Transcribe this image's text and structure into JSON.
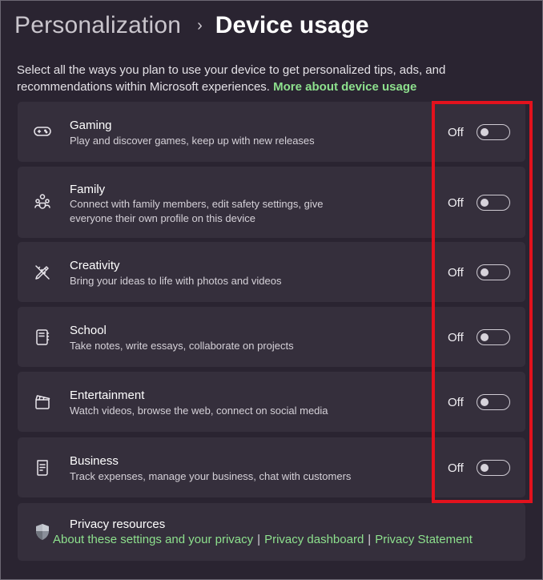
{
  "breadcrumb": {
    "parent": "Personalization",
    "separator": "›",
    "current": "Device usage"
  },
  "description": {
    "text": "Select all the ways you plan to use your device to get personalized tips, ads, and recommendations within Microsoft experiences.",
    "link": "More about device usage"
  },
  "items": [
    {
      "title": "Gaming",
      "subtitle": "Play and discover games, keep up with new releases",
      "state": "Off",
      "icon": "gamepad-icon"
    },
    {
      "title": "Family",
      "subtitle": "Connect with family members, edit safety settings, give everyone their own profile on this device",
      "state": "Off",
      "icon": "family-icon"
    },
    {
      "title": "Creativity",
      "subtitle": "Bring your ideas to life with photos and videos",
      "state": "Off",
      "icon": "pen-ruler-icon"
    },
    {
      "title": "School",
      "subtitle": "Take notes, write essays, collaborate on projects",
      "state": "Off",
      "icon": "notebook-icon"
    },
    {
      "title": "Entertainment",
      "subtitle": "Watch videos, browse the web, connect on social media",
      "state": "Off",
      "icon": "clapperboard-icon"
    },
    {
      "title": "Business",
      "subtitle": "Track expenses, manage your business, chat with customers",
      "state": "Off",
      "icon": "receipt-icon"
    }
  ],
  "privacy": {
    "title": "Privacy resources",
    "links": [
      "About these settings and your privacy",
      "Privacy dashboard",
      "Privacy Statement"
    ],
    "separator": "|",
    "icon": "shield-icon"
  },
  "colors": {
    "accent_link": "#8de08d",
    "highlight": "#e3121d",
    "card": "#352f3c",
    "background": "#2a2431"
  }
}
